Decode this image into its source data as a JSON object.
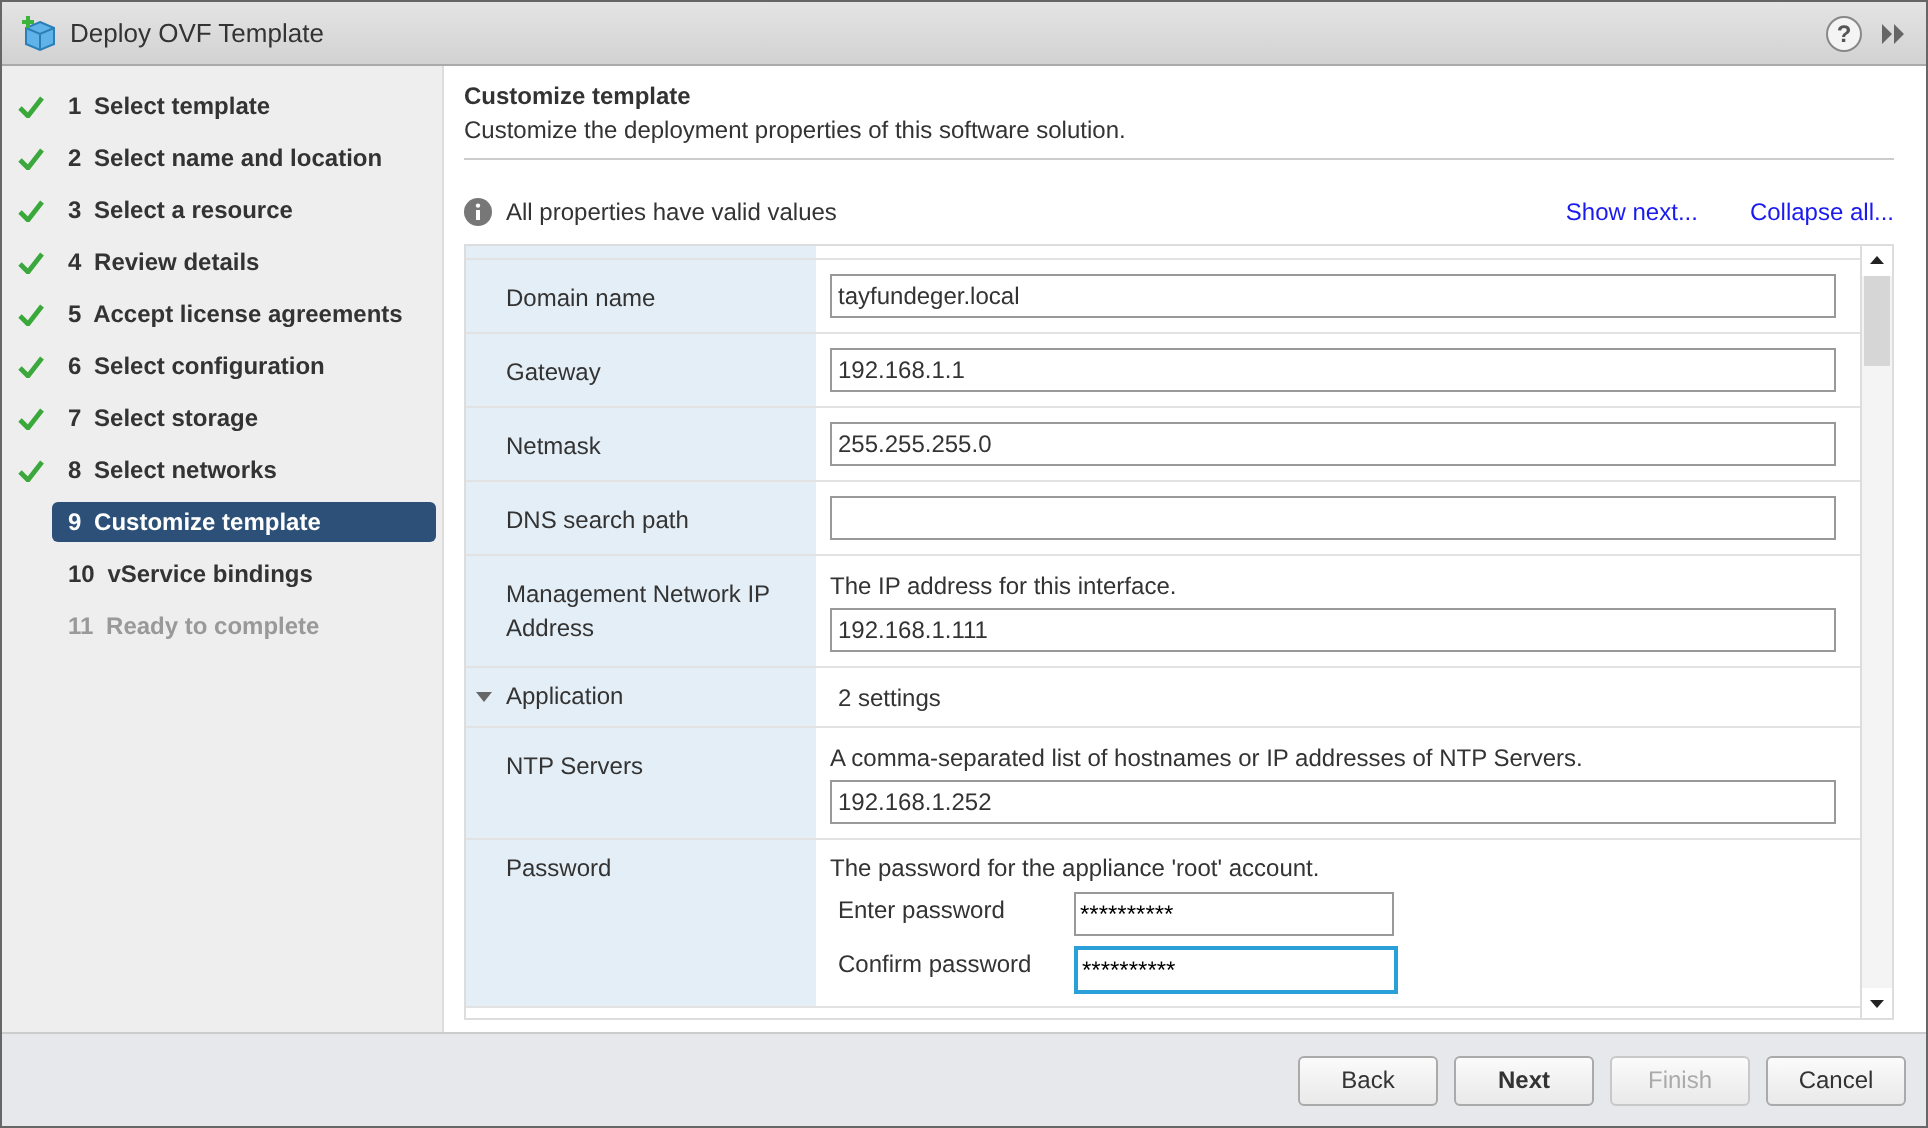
{
  "window": {
    "title": "Deploy OVF Template",
    "help": "?"
  },
  "steps": [
    {
      "number": "1",
      "label": "Select template",
      "completed": true,
      "selected": false,
      "disabled": false
    },
    {
      "number": "2",
      "label": "Select name and location",
      "completed": true,
      "selected": false,
      "disabled": false
    },
    {
      "number": "3",
      "label": "Select a resource",
      "completed": true,
      "selected": false,
      "disabled": false
    },
    {
      "number": "4",
      "label": "Review details",
      "completed": true,
      "selected": false,
      "disabled": false
    },
    {
      "number": "5",
      "label": "Accept license agreements",
      "completed": true,
      "selected": false,
      "disabled": false
    },
    {
      "number": "6",
      "label": "Select configuration",
      "completed": true,
      "selected": false,
      "disabled": false
    },
    {
      "number": "7",
      "label": "Select storage",
      "completed": true,
      "selected": false,
      "disabled": false
    },
    {
      "number": "8",
      "label": "Select networks",
      "completed": true,
      "selected": false,
      "disabled": false
    },
    {
      "number": "9",
      "label": "Customize template",
      "completed": false,
      "selected": true,
      "disabled": false
    },
    {
      "number": "10",
      "label": "vService bindings",
      "completed": false,
      "selected": false,
      "disabled": false
    },
    {
      "number": "11",
      "label": "Ready to complete",
      "completed": false,
      "selected": false,
      "disabled": true
    }
  ],
  "page": {
    "title": "Customize template",
    "subtitle": "Customize the deployment properties of this software solution."
  },
  "status": "All properties have valid values",
  "links": [
    "Show next...",
    "Collapse all..."
  ],
  "properties": [
    {
      "kind": "field",
      "label": "Domain name",
      "value": "tayfundeger.local"
    },
    {
      "kind": "field",
      "label": "Gateway",
      "value": "192.168.1.1"
    },
    {
      "kind": "field",
      "label": "Netmask",
      "value": "255.255.255.0"
    },
    {
      "kind": "field",
      "label": "DNS search path"
    },
    {
      "kind": "field",
      "label": "Management Network IP Address",
      "description": "The IP address for this interface.",
      "value": "192.168.1.111"
    },
    {
      "kind": "group",
      "label": "Application",
      "expanded": true,
      "summary": "2 settings"
    },
    {
      "kind": "field",
      "label": "NTP Servers",
      "description": "A comma-separated list of hostnames or IP addresses of NTP Servers.",
      "value": "192.168.1.252"
    },
    {
      "kind": "password",
      "label": "Password",
      "description": "The password for the appliance 'root' account.",
      "fields": [
        {
          "label": "Enter password",
          "value": "**********",
          "focused": false
        },
        {
          "label": "Confirm password",
          "value": "**********",
          "focused": true
        }
      ]
    }
  ],
  "buttons": [
    {
      "label": "Back",
      "primary": false,
      "disabled": false
    },
    {
      "label": "Next",
      "primary": true,
      "disabled": false
    },
    {
      "label": "Finish",
      "primary": false,
      "disabled": true
    },
    {
      "label": "Cancel",
      "primary": false,
      "disabled": false
    }
  ]
}
